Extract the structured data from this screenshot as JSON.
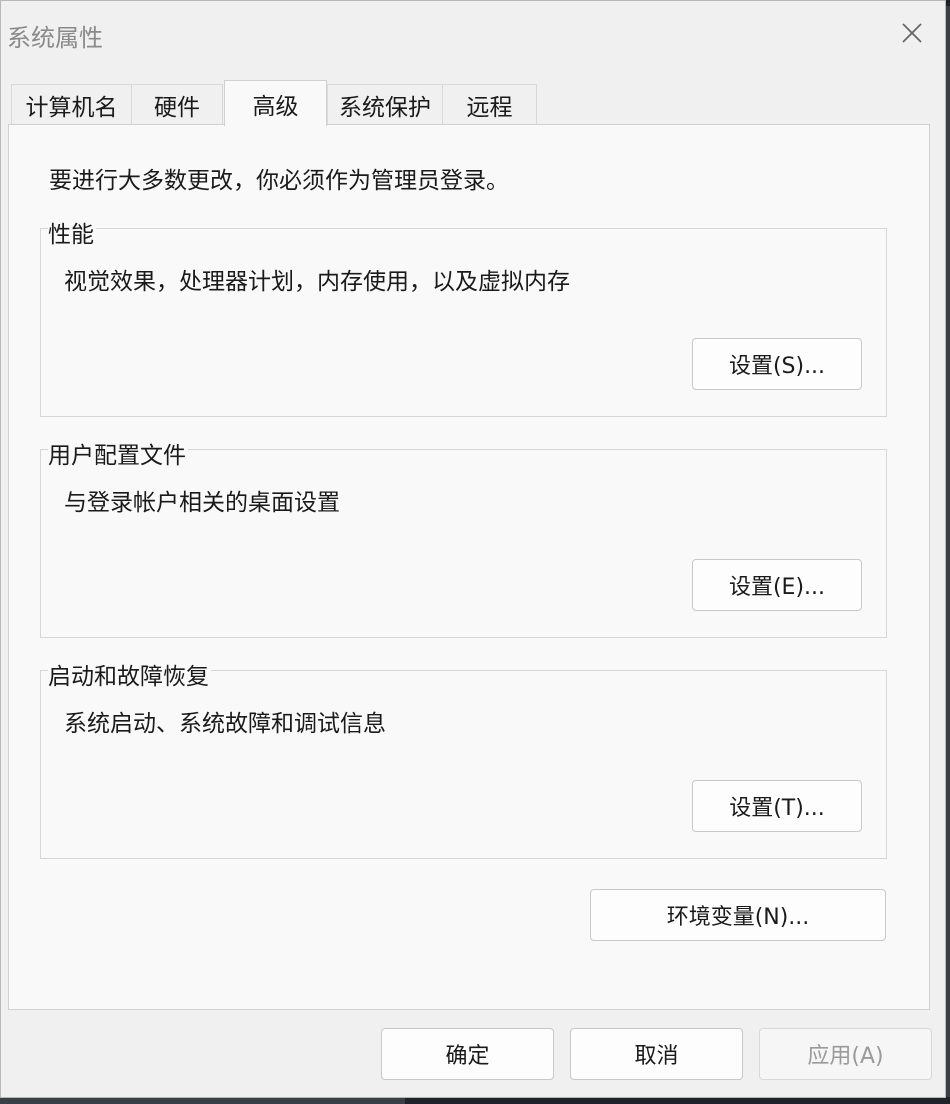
{
  "window": {
    "title": "系统属性"
  },
  "tabs": [
    {
      "label": "计算机名"
    },
    {
      "label": "硬件"
    },
    {
      "label": "高级"
    },
    {
      "label": "系统保护"
    },
    {
      "label": "远程"
    }
  ],
  "notice": "要进行大多数更改，你必须作为管理员登录。",
  "groups": {
    "performance": {
      "label": "性能",
      "description": "视觉效果，处理器计划，内存使用，以及虚拟内存",
      "button": "设置(S)..."
    },
    "user_profiles": {
      "label": "用户配置文件",
      "description": "与登录帐户相关的桌面设置",
      "button": "设置(E)..."
    },
    "startup_recovery": {
      "label": "启动和故障恢复",
      "description": "系统启动、系统故障和调试信息",
      "button": "设置(T)..."
    }
  },
  "env_button": "环境变量(N)...",
  "footer": {
    "ok": "确定",
    "cancel": "取消",
    "apply": "应用(A)"
  }
}
